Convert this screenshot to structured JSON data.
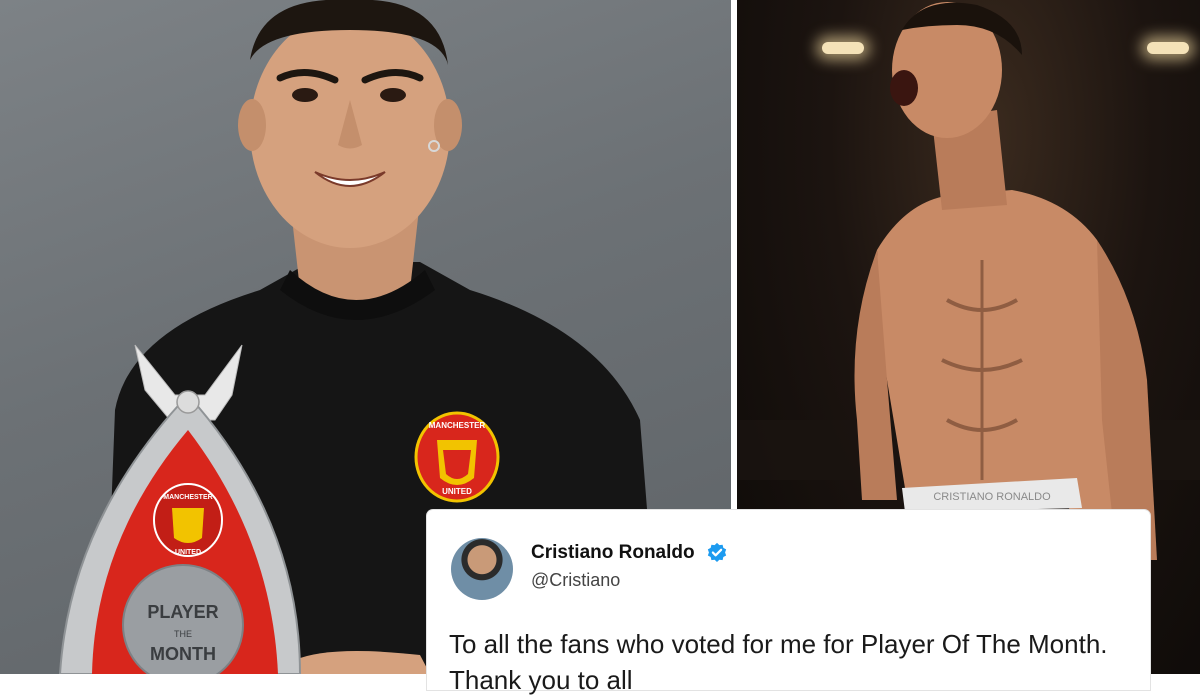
{
  "tweet": {
    "name": "Cristiano Ronaldo",
    "handle": "@Cristiano",
    "verified": true,
    "text": "To all the fans who voted for me for Player Of The Month. Thank you to all"
  },
  "trophy": {
    "badge_text_top": "MANCHESTER",
    "badge_text_bottom": "UNITED",
    "plaque_line1": "PLAYER",
    "plaque_line2": "THE",
    "plaque_line3": "MONTH"
  },
  "shirt_badge": {
    "top": "MANCHESTER",
    "bottom": "UNITED"
  },
  "waistband_text": "CRISTIANO RONALDO",
  "colors": {
    "verified": "#1d9bf0",
    "trophy_red": "#d8261c",
    "shirt": "#141414"
  }
}
